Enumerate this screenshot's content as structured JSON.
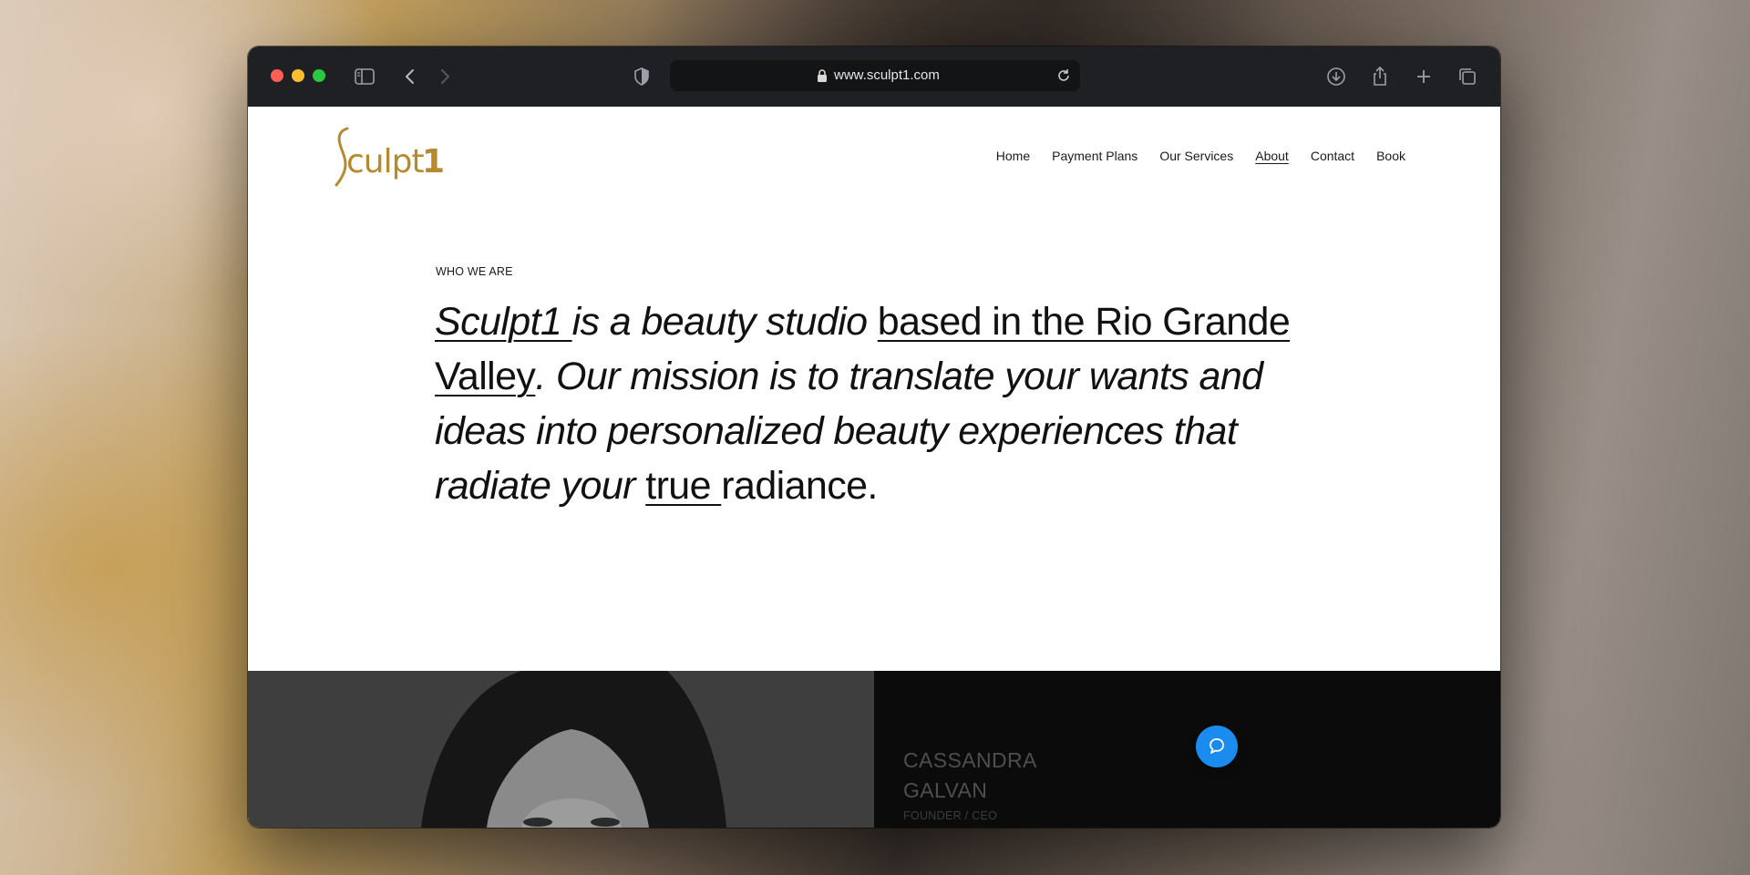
{
  "browser": {
    "url": "www.sculpt1.com"
  },
  "site": {
    "logo_text": "Sculpt1",
    "brand_color": "#b68b2e",
    "nav": [
      {
        "label": "Home"
      },
      {
        "label": "Payment Plans"
      },
      {
        "label": "Our Services"
      },
      {
        "label": "About",
        "active": true
      },
      {
        "label": "Contact"
      },
      {
        "label": "Book"
      }
    ]
  },
  "about": {
    "eyebrow": "WHO WE ARE",
    "headline": {
      "p1": "Sculpt1 ",
      "p2": "is a beauty studio ",
      "p3": "based in the Rio Grande Valley",
      "p4": ". Our mission is to translate your wants and ideas into personalized beauty experiences that radiate your ",
      "p5": "true ",
      "p6": "radiance."
    }
  },
  "team": {
    "member_name_line1": "CASSANDRA",
    "member_name_line2": "GALVAN",
    "member_role": "FOUNDER / CEO"
  },
  "colors": {
    "chat_button": "#1a8cf0",
    "toolbar": "#1e2023"
  }
}
